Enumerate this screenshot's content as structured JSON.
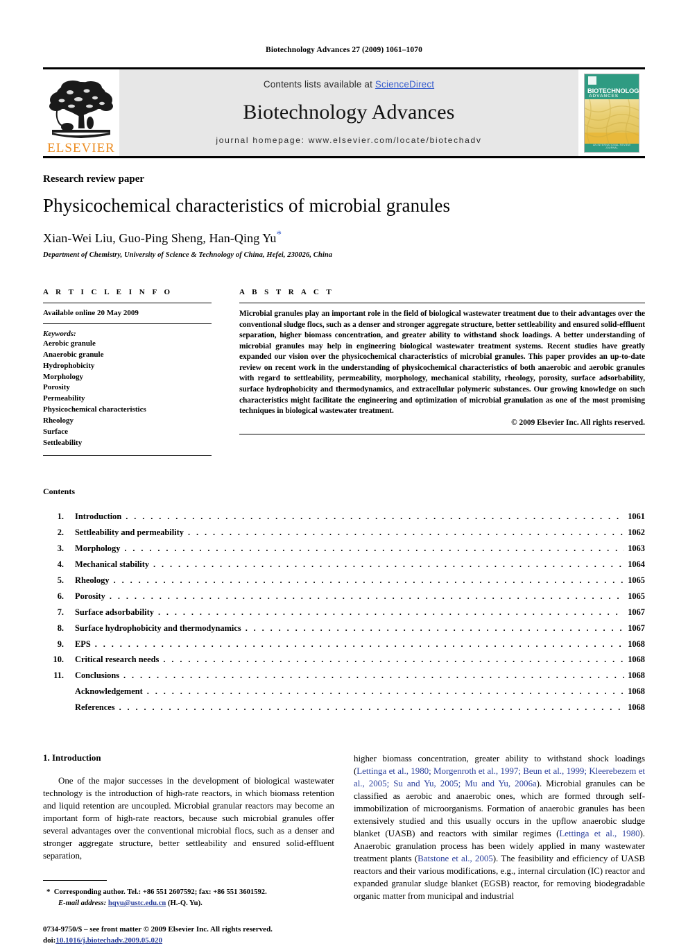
{
  "running_head": "Biotechnology Advances 27 (2009) 1061–1070",
  "masthead": {
    "publisher_logo_word": "ELSEVIER",
    "contents_lists_prefix": "Contents lists available at ",
    "sciencedirect_link": "ScienceDirect",
    "journal_name": "Biotechnology Advances",
    "homepage_line": "journal homepage: www.elsevier.com/locate/biotechadv",
    "cover": {
      "title": "BIOTECHNOLOGY",
      "subtitle": "ADVANCES",
      "footer": "AN INTERNATIONAL REVIEW JOURNAL"
    },
    "link_color": "#3a5fcd",
    "band_color": "#e7e7e7"
  },
  "article": {
    "type": "Research review paper",
    "title": "Physicochemical characteristics of microbial granules",
    "authors": "Xian-Wei Liu, Guo-Ping Sheng, Han-Qing Yu",
    "corresponding_marker": "*",
    "affiliation": "Department of Chemistry, University of Science & Technology of China, Hefei, 230026, China"
  },
  "article_info": {
    "heading": "A R T I C L E    I N F O",
    "available_online": "Available online 20 May 2009",
    "keywords_label": "Keywords:",
    "keywords": [
      "Aerobic granule",
      "Anaerobic granule",
      "Hydrophobicity",
      "Morphology",
      "Porosity",
      "Permeability",
      "Physicochemical characteristics",
      "Rheology",
      "Surface",
      "Settleability"
    ]
  },
  "abstract": {
    "heading": "A B S T R A C T",
    "text": "Microbial granules play an important role in the field of biological wastewater treatment due to their advantages over the conventional sludge flocs, such as a denser and stronger aggregate structure, better settleability and ensured solid-effluent separation, higher biomass concentration, and greater ability to withstand shock loadings. A better understanding of microbial granules may help in engineering biological wastewater treatment systems. Recent studies have greatly expanded our vision over the physicochemical characteristics of microbial granules. This paper provides an up-to-date review on recent work in the understanding of physicochemical characteristics of both anaerobic and aerobic granules with regard to settleability, permeability, morphology, mechanical stability, rheology, porosity, surface adsorbability, surface hydrophobicity and thermodynamics, and extracellular polymeric substances. Our growing knowledge on such characteristics might facilitate the engineering and optimization of microbial granulation as one of the most promising techniques in biological wastewater treatment.",
    "copyright": "© 2009 Elsevier Inc. All rights reserved."
  },
  "contents": {
    "heading": "Contents",
    "entries": [
      {
        "num": "1.",
        "label": "Introduction",
        "page": "1061"
      },
      {
        "num": "2.",
        "label": "Settleability and permeability",
        "page": "1062"
      },
      {
        "num": "3.",
        "label": "Morphology",
        "page": "1063"
      },
      {
        "num": "4.",
        "label": "Mechanical stability",
        "page": "1064"
      },
      {
        "num": "5.",
        "label": "Rheology",
        "page": "1065"
      },
      {
        "num": "6.",
        "label": "Porosity",
        "page": "1065"
      },
      {
        "num": "7.",
        "label": "Surface adsorbability",
        "page": "1067"
      },
      {
        "num": "8.",
        "label": "Surface hydrophobicity and thermodynamics",
        "page": "1067"
      },
      {
        "num": "9.",
        "label": "EPS",
        "page": "1068"
      },
      {
        "num": "10.",
        "label": "Critical research needs",
        "page": "1068"
      },
      {
        "num": "11.",
        "label": "Conclusions",
        "page": "1068"
      },
      {
        "num": "",
        "label": "Acknowledgement",
        "page": "1068"
      },
      {
        "num": "",
        "label": "References",
        "page": "1068"
      }
    ]
  },
  "body": {
    "section_heading": "1. Introduction",
    "left_paragraph": "One of the major successes in the development of biological wastewater technology is the introduction of high-rate reactors, in which biomass retention and liquid retention are uncoupled. Microbial granular reactors may become an important form of high-rate reactors, because such microbial granules offer several advantages over the conventional microbial flocs, such as a denser and stronger aggregate structure, better settleability and ensured solid-effluent separation,",
    "right_paragraph_1": "higher biomass concentration, greater ability to withstand shock loadings (",
    "right_cite_1": "Lettinga et al., 1980; Morgenroth et al., 1997; Beun et al., 1999; Kleerebezem et al., 2005; Su and Yu, 2005; Mu and Yu, 2006a",
    "right_paragraph_2": "). Microbial granules can be classified as aerobic and anaerobic ones, which are formed through self-immobilization of microorganisms. Formation of anaerobic granules has been extensively studied and this usually occurs in the upflow anaerobic sludge blanket (UASB) and reactors with similar regimes (",
    "right_cite_2": "Lettinga et al., 1980",
    "right_paragraph_3": "). Anaerobic granulation process has been widely applied in many wastewater treatment plants (",
    "right_cite_3": "Batstone et al., 2005",
    "right_paragraph_4": "). The feasibility and efficiency of UASB reactors and their various modifications, e.g., internal circulation (IC) reactor and expanded granular sludge blanket (EGSB) reactor, for removing biodegradable organic matter from municipal and industrial"
  },
  "footnote": {
    "marker": "*",
    "corresponding": "Corresponding author. Tel.: +86 551 2607592; fax: +86 551 3601592.",
    "email_label": "E-mail address:",
    "email": "hqyu@ustc.edu.cn",
    "email_suffix": "(H.-Q. Yu)."
  },
  "imprint": {
    "front_matter": "0734-9750/$ – see front matter © 2009 Elsevier Inc. All rights reserved.",
    "doi_label": "doi:",
    "doi": "10.1016/j.biotechadv.2009.05.020"
  }
}
